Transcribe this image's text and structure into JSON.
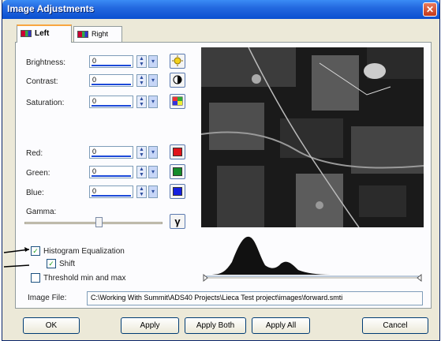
{
  "window": {
    "title": "Image Adjustments",
    "close_glyph": "✕"
  },
  "tabs": [
    {
      "label": "Left",
      "active": true
    },
    {
      "label": "Right",
      "active": false
    }
  ],
  "adjustments": {
    "brightness": {
      "label": "Brightness:",
      "value": "0"
    },
    "contrast": {
      "label": "Contrast:",
      "value": "0"
    },
    "saturation": {
      "label": "Saturation:",
      "value": "0"
    },
    "red": {
      "label": "Red:",
      "value": "0",
      "color": "#e0141b"
    },
    "green": {
      "label": "Green:",
      "value": "0",
      "color": "#148c2a"
    },
    "blue": {
      "label": "Blue:",
      "value": "0",
      "color": "#1420e0"
    },
    "gamma": {
      "label": "Gamma:",
      "button_glyph": "γ"
    }
  },
  "options": {
    "histogram_equalization": {
      "label": "Histogram Equalization",
      "checked": true
    },
    "shift": {
      "label": "Shift",
      "checked": true
    },
    "threshold": {
      "label": "Threshold min and max",
      "checked": false
    }
  },
  "image_file": {
    "label": "Image File:",
    "path": "C:\\Working With Summit\\ADS40 Projects\\Lieca Test project\\images\\forward.smti"
  },
  "buttons": {
    "ok": "OK",
    "apply": "Apply",
    "apply_both": "Apply Both",
    "apply_all": "Apply All",
    "cancel": "Cancel"
  }
}
